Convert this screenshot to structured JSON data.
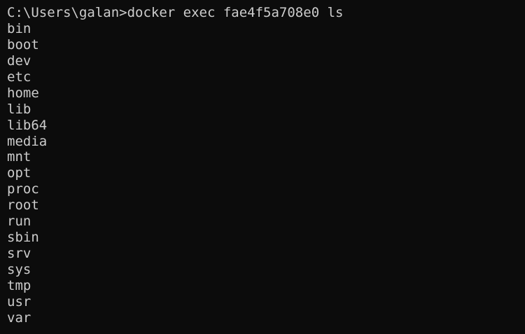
{
  "terminal": {
    "prompt": "C:\\Users\\galan>",
    "command": "docker exec fae4f5a708e0 ls",
    "output": [
      "bin",
      "boot",
      "dev",
      "etc",
      "home",
      "lib",
      "lib64",
      "media",
      "mnt",
      "opt",
      "proc",
      "root",
      "run",
      "sbin",
      "srv",
      "sys",
      "tmp",
      "usr",
      "var"
    ]
  },
  "colors": {
    "background": "#0c0c0c",
    "foreground": "#cccccc"
  }
}
